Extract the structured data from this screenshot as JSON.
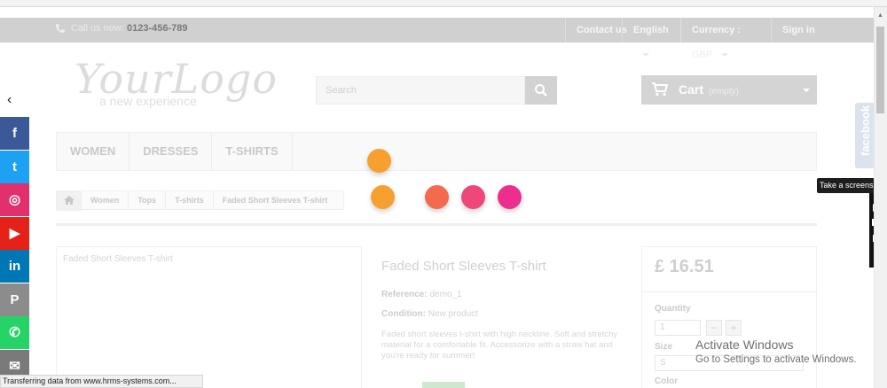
{
  "topbar": {
    "call_label": "Call us now:",
    "phone": "0123-456-789",
    "contact": "Contact us",
    "language": "English",
    "currency_label": "Currency :",
    "currency_value": "GBP",
    "sign_in": "Sign in"
  },
  "header": {
    "logo_text": "YourLogo",
    "logo_tagline": "a new experience",
    "search_placeholder": "Search",
    "cart_label": "Cart",
    "cart_state": "(empty)"
  },
  "menu": {
    "items": [
      "WOMEN",
      "DRESSES",
      "T-SHIRTS"
    ]
  },
  "breadcrumb": {
    "items": [
      "Women",
      "Tops",
      "T-shirts",
      "Faded Short Sleeves T-shirt"
    ]
  },
  "product": {
    "image_caption": "Faded Short Sleeves T-shirt",
    "title": "Faded Short Sleeves T-shirt",
    "reference_label": "Reference:",
    "reference_value": "demo_1",
    "condition_label": "Condition:",
    "condition_value": "New product",
    "description": "Faded short sleeves t-shirt with high neckline. Soft and stretchy material for a comfortable fit. Accessorize with a straw hat and you're ready for summer!",
    "price": "£ 16.51",
    "quantity_label": "Quantity",
    "quantity_value": "1",
    "size_label": "Size",
    "size_value": "S",
    "color_label": "Color"
  },
  "overlay": {
    "activate_title": "Activate Windows",
    "activate_sub": "Go to Settings to activate Windows.",
    "dot_colors": [
      "#f7a030",
      "#f7a030",
      "#f36b4f",
      "#f0477a",
      "#ee2e8e"
    ]
  },
  "social": {
    "items": [
      {
        "name": "facebook",
        "glyph": "f",
        "color": "#3b5998"
      },
      {
        "name": "twitter",
        "glyph": "t",
        "color": "#1da1f2"
      },
      {
        "name": "instagram",
        "glyph": "◎",
        "color": "#e1306c"
      },
      {
        "name": "youtube",
        "glyph": "▶",
        "color": "#e62117"
      },
      {
        "name": "linkedin",
        "glyph": "in",
        "color": "#0077b5"
      },
      {
        "name": "pinterest",
        "glyph": "P",
        "color": "#8c8c8c"
      },
      {
        "name": "whatsapp",
        "glyph": "✆",
        "color": "#25d366"
      },
      {
        "name": "email",
        "glyph": "✉",
        "color": "#7a7a7a"
      }
    ]
  },
  "facebook_tab": "facebook",
  "screenshot_tool": {
    "tooltip": "Take a screenshot"
  },
  "statusbar": "Transferring data from www.hrms-systems.com..."
}
